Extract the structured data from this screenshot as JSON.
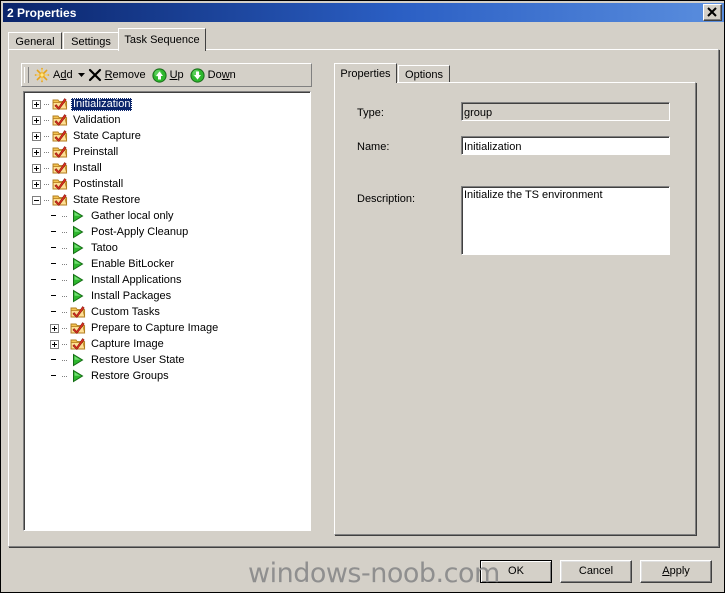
{
  "window": {
    "title": "2 Properties",
    "close_icon": "close-icon"
  },
  "tabs": [
    {
      "label": "General",
      "active": false
    },
    {
      "label": "Settings",
      "active": false
    },
    {
      "label": "Task Sequence",
      "active": true
    }
  ],
  "toolbar": {
    "add_label": "Add",
    "add_accel": "d",
    "add_icon": "starburst-icon",
    "dropdown_icon": "chevron-down-icon",
    "remove_label": "Remove",
    "remove_accel": "R",
    "remove_icon": "x-icon",
    "up_label": "Up",
    "up_accel": "U",
    "up_icon": "arrow-up-circle-icon",
    "down_label": "Down",
    "down_accel": "w",
    "down_icon": "arrow-down-circle-icon"
  },
  "tree": [
    {
      "label": "Initialization",
      "level": 0,
      "kind": "group",
      "expander": "plus",
      "selected": true
    },
    {
      "label": "Validation",
      "level": 0,
      "kind": "group",
      "expander": "plus",
      "selected": false
    },
    {
      "label": "State Capture",
      "level": 0,
      "kind": "group",
      "expander": "plus",
      "selected": false
    },
    {
      "label": "Preinstall",
      "level": 0,
      "kind": "group",
      "expander": "plus",
      "selected": false
    },
    {
      "label": "Install",
      "level": 0,
      "kind": "group",
      "expander": "plus",
      "selected": false
    },
    {
      "label": "Postinstall",
      "level": 0,
      "kind": "group",
      "expander": "plus",
      "selected": false
    },
    {
      "label": "State Restore",
      "level": 0,
      "kind": "group",
      "expander": "minus",
      "selected": false
    },
    {
      "label": "Gather local only",
      "level": 1,
      "kind": "step",
      "expander": "none",
      "selected": false
    },
    {
      "label": "Post-Apply Cleanup",
      "level": 1,
      "kind": "step",
      "expander": "none",
      "selected": false
    },
    {
      "label": "Tatoo",
      "level": 1,
      "kind": "step",
      "expander": "none",
      "selected": false
    },
    {
      "label": "Enable BitLocker",
      "level": 1,
      "kind": "step",
      "expander": "none",
      "selected": false
    },
    {
      "label": "Install Applications",
      "level": 1,
      "kind": "step",
      "expander": "none",
      "selected": false
    },
    {
      "label": "Install Packages",
      "level": 1,
      "kind": "step",
      "expander": "none",
      "selected": false
    },
    {
      "label": "Custom Tasks",
      "level": 1,
      "kind": "group",
      "expander": "none",
      "selected": false
    },
    {
      "label": "Prepare to Capture Image",
      "level": 1,
      "kind": "group",
      "expander": "plus",
      "selected": false
    },
    {
      "label": "Capture Image",
      "level": 1,
      "kind": "group",
      "expander": "plus",
      "selected": false
    },
    {
      "label": "Restore User State",
      "level": 1,
      "kind": "step",
      "expander": "none",
      "selected": false
    },
    {
      "label": "Restore Groups",
      "level": 1,
      "kind": "step",
      "expander": "none",
      "selected": false
    }
  ],
  "details": {
    "tabs": [
      {
        "label": "Properties",
        "active": true
      },
      {
        "label": "Options",
        "active": false
      }
    ],
    "type_label": "Type:",
    "type_value": "group",
    "name_label": "Name:",
    "name_value": "Initialization",
    "description_label": "Description:",
    "description_value": "Initialize the TS environment"
  },
  "footer": {
    "ok_label": "OK",
    "cancel_label": "Cancel",
    "apply_label": "Apply",
    "apply_accel": "A"
  },
  "watermark": "windows-noob.com",
  "colors": {
    "face": "#d4d0c8",
    "title_start": "#0a246a",
    "selection": "#0a246a",
    "step_green": "#2eb82e",
    "folder_yellow": "#ffcc66",
    "check_red": "#e03020"
  }
}
